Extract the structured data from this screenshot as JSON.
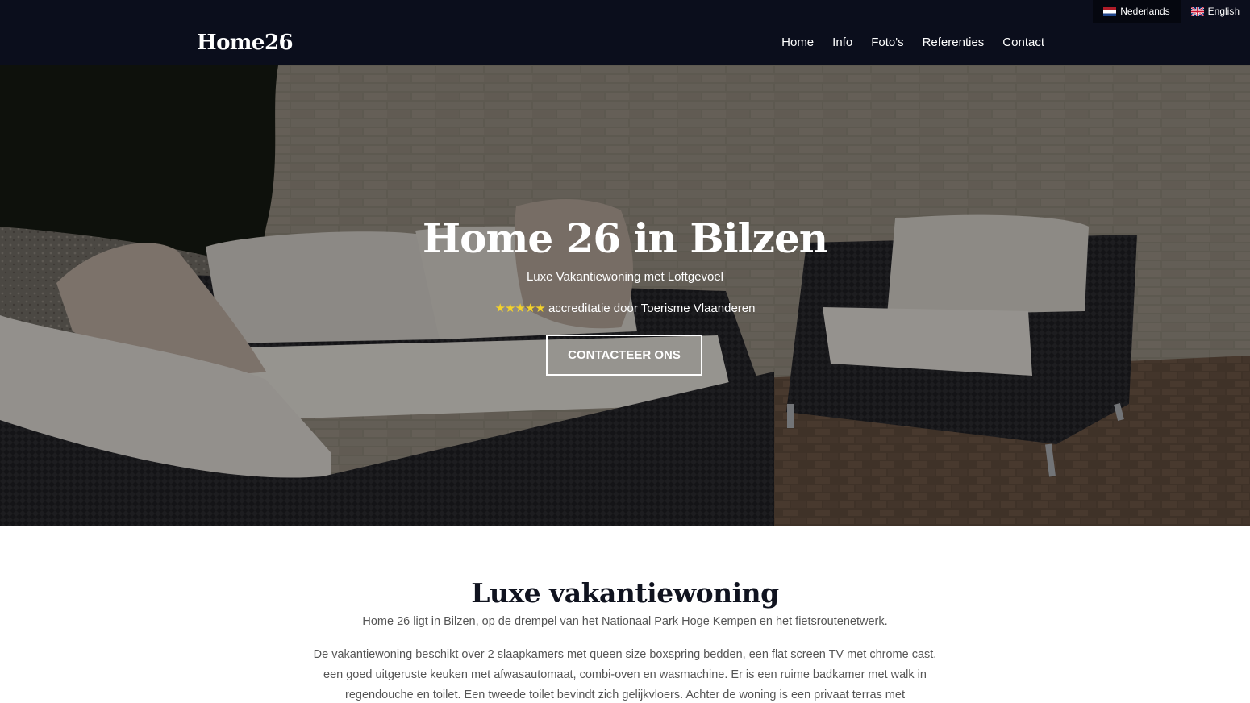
{
  "header": {
    "brand": "Home26",
    "languages": [
      {
        "label": "Nederlands",
        "active": true
      },
      {
        "label": "English",
        "active": false
      }
    ],
    "nav": [
      "Home",
      "Info",
      "Foto's",
      "Referenties",
      "Contact"
    ]
  },
  "hero": {
    "title": "Home 26 in Bilzen",
    "subtitle": "Luxe Vakantiewoning met Loftgevoel",
    "stars": "★★★★★",
    "accreditation": "accreditatie door Toerisme Vlaanderen",
    "cta": "CONTACTEER ONS"
  },
  "intro": {
    "title": "Luxe vakantiewoning",
    "paragraph1": "Home 26 ligt in Bilzen, op de drempel van het Nationaal Park Hoge Kempen en het fietsroutenetwerk.",
    "paragraph2": "De vakantiewoning beschikt over 2 slaapkamers met queen size boxspring bedden, een flat screen TV met chrome cast, een goed uitgeruste keuken met afwasautomaat, combi-oven en wasmachine. Er is een ruime badkamer met walk in regendouche en toilet. Een tweede toilet bevindt zich gelijkvloers. Achter de woning is een privaat terras met"
  },
  "colors": {
    "header_bg": "#0b0e1c",
    "star": "#f2d12d",
    "heading": "#10131f"
  }
}
